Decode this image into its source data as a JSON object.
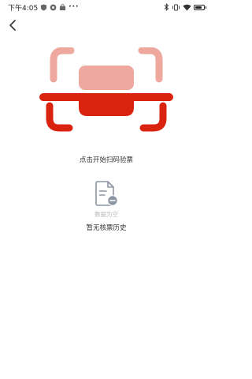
{
  "status_bar": {
    "time": "下午4:05",
    "dots": "···",
    "icons": [
      "shield-icon",
      "badge-icon",
      "bag-icon",
      "bluetooth-icon",
      "vibrate-icon",
      "wifi-icon",
      "battery-icon"
    ],
    "battery_level": 0.85
  },
  "header": {
    "back_icon": "chevron-left-icon"
  },
  "scan": {
    "caption": "点击开始扫码验票",
    "accent_color": "#d9230f",
    "light_color": "#eea89e"
  },
  "history": {
    "empty_text": "数据为空",
    "label": "暂无核票历史",
    "empty_icon": "document-remove-icon"
  }
}
